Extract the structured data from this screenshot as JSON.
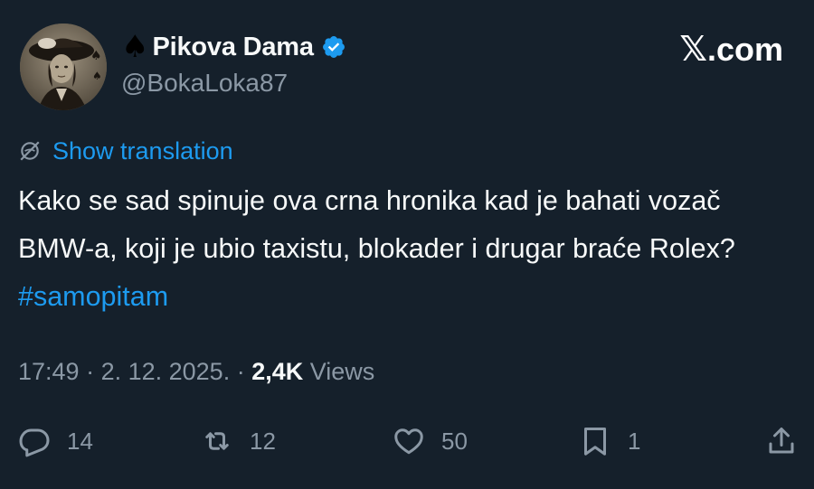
{
  "author": {
    "display_name": "Pikova Dama",
    "handle": "@BokaLoka87",
    "verified": true,
    "name_prefix_icon": "spade-icon"
  },
  "brand": {
    "logo_mark": "𝕏",
    "logo_text": ".com"
  },
  "translation": {
    "label": "Show translation",
    "icon": "globe-slash-icon"
  },
  "tweet": {
    "text": "Kako se sad spinuje ova crna hronika kad je bahati vozač BMW-a, koji je ubio taxistu, blokader i drugar braće Rolex? ",
    "hashtag": "#samopitam"
  },
  "meta": {
    "time": "17:49",
    "sep1": " · ",
    "date": "2. 12. 2025.",
    "sep2": " · ",
    "views_count": "2,4K",
    "views_label": " Views"
  },
  "actions": {
    "replies": "14",
    "reposts": "12",
    "likes": "50",
    "bookmarks": "1"
  },
  "colors": {
    "background": "#15202b",
    "text": "#f7f9f9",
    "secondary": "#8b98a5",
    "accent": "#1d9bf0"
  }
}
